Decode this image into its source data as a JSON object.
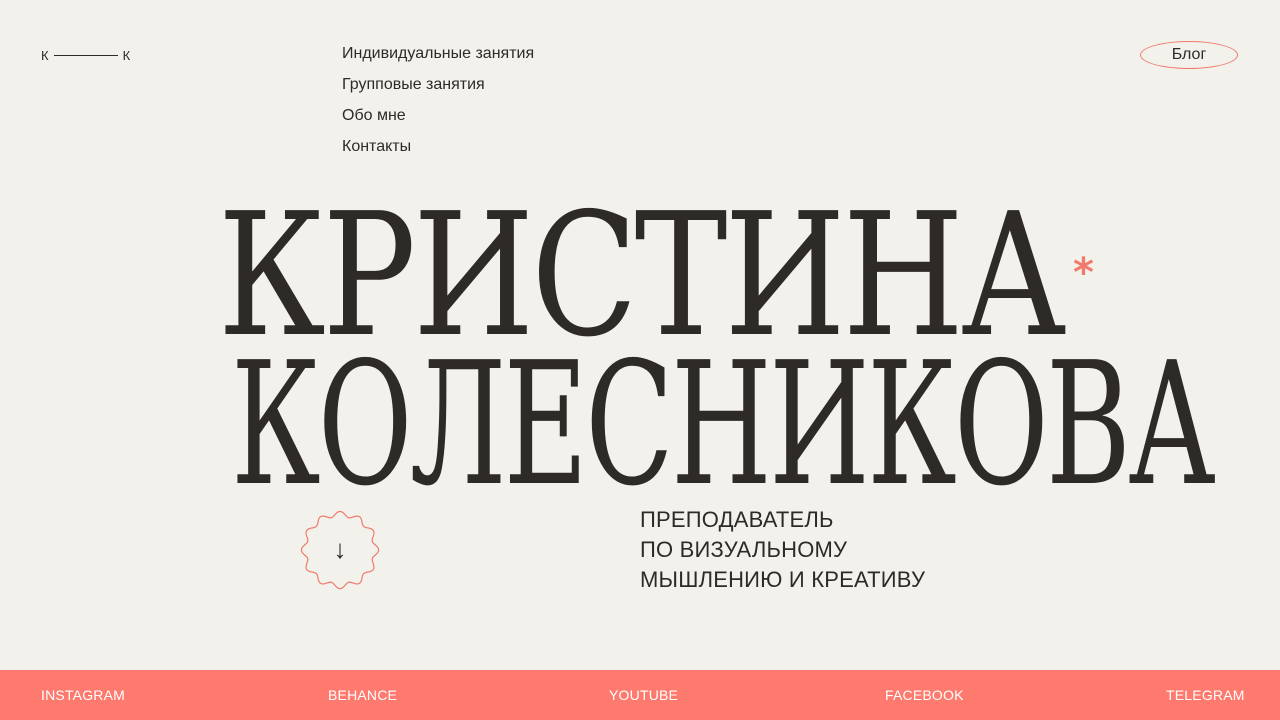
{
  "logo": {
    "left": "К",
    "right": "К"
  },
  "nav": {
    "items": [
      {
        "label": "Индивидуальные занятия"
      },
      {
        "label": "Групповые занятия"
      },
      {
        "label": "Обо мне"
      },
      {
        "label": "Контакты"
      }
    ],
    "blog_label": "Блог"
  },
  "hero": {
    "first_name": "КРИСТИНА",
    "last_name": "КОЛЕСНИКОВА",
    "asterisk": "*"
  },
  "scroll": {
    "arrow": "↓"
  },
  "subtitle": {
    "lines": [
      "ПРЕПОДАВАТЕЛЬ",
      "ПО ВИЗУАЛЬНОМУ",
      "МЫШЛЕНИЮ И КРЕАТИВУ"
    ]
  },
  "footer": {
    "links": [
      {
        "label": "INSTAGRAM"
      },
      {
        "label": "BEHANCE"
      },
      {
        "label": "YOUTUBE"
      },
      {
        "label": "FACEBOOK"
      },
      {
        "label": "TELEGRAM"
      }
    ]
  },
  "colors": {
    "background": "#f3f1ec",
    "text": "#2e2b26",
    "accent": "#ff7a6e"
  }
}
